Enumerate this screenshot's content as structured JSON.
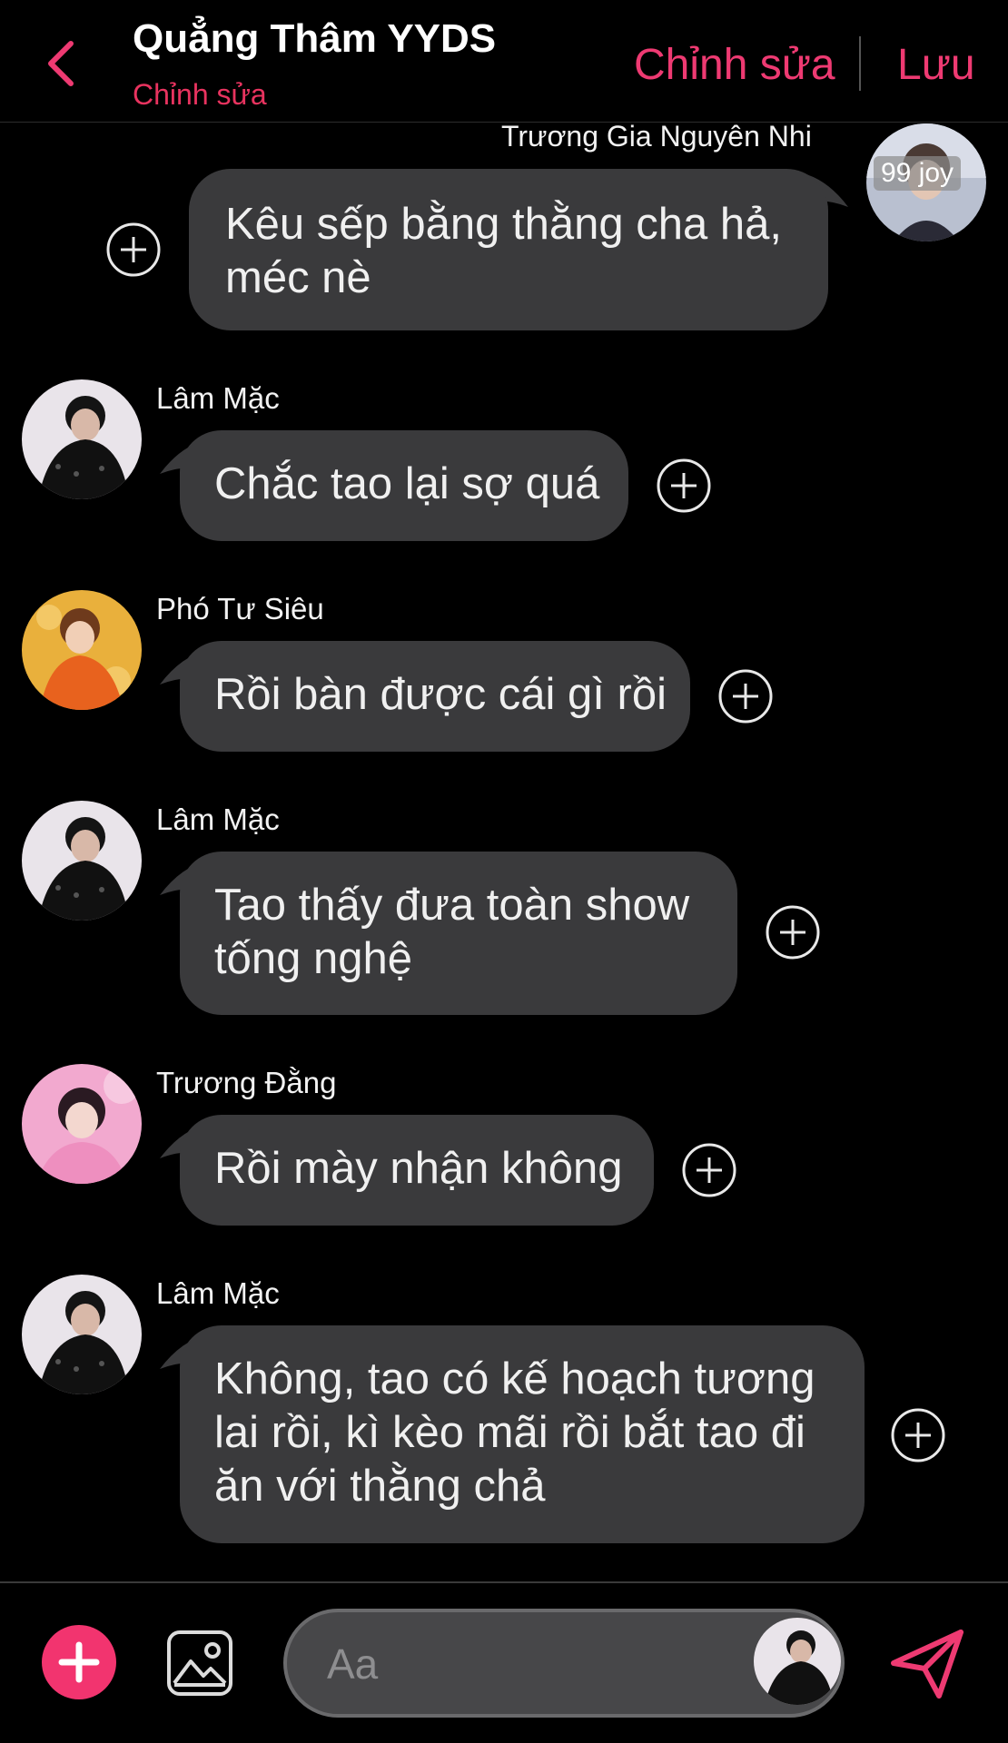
{
  "header": {
    "title": "Quẳng Thâm YYDS",
    "subtitle": "Chỉnh sửa",
    "edit_label": "Chỉnh sửa",
    "save_label": "Lưu"
  },
  "top_message": {
    "sender": "Trương Gia Nguyên Nhi",
    "lines": [
      "Kêu sếp bằng thằng cha hả,",
      "méc nè"
    ],
    "avatar_watermark": "99 joy"
  },
  "messages": [
    {
      "sender": "Lâm Mặc",
      "lines": [
        "Chắc tao lại sợ quá"
      ]
    },
    {
      "sender": "Phó Tư Siêu",
      "lines": [
        "Rồi bàn được cái gì rồi"
      ]
    },
    {
      "sender": "Lâm Mặc",
      "lines": [
        "Tao thấy đưa toàn show",
        "tống nghệ"
      ]
    },
    {
      "sender": "Trương Đằng",
      "lines": [
        "Rồi mày nhận không"
      ]
    },
    {
      "sender": "Lâm Mặc",
      "lines": [
        "Không, tao có kế hoạch tương",
        "lai rồi, kì kèo mãi rồi bắt tao đi",
        "ăn với thằng chả"
      ]
    }
  ],
  "composer": {
    "placeholder": "Aa"
  },
  "colors": {
    "accent": "#ee3a72",
    "bubble": "#3a3a3c",
    "background": "#000000"
  },
  "icons": [
    "back-chevron-icon",
    "add-circle-icon",
    "plus-icon",
    "image-icon",
    "send-icon"
  ]
}
